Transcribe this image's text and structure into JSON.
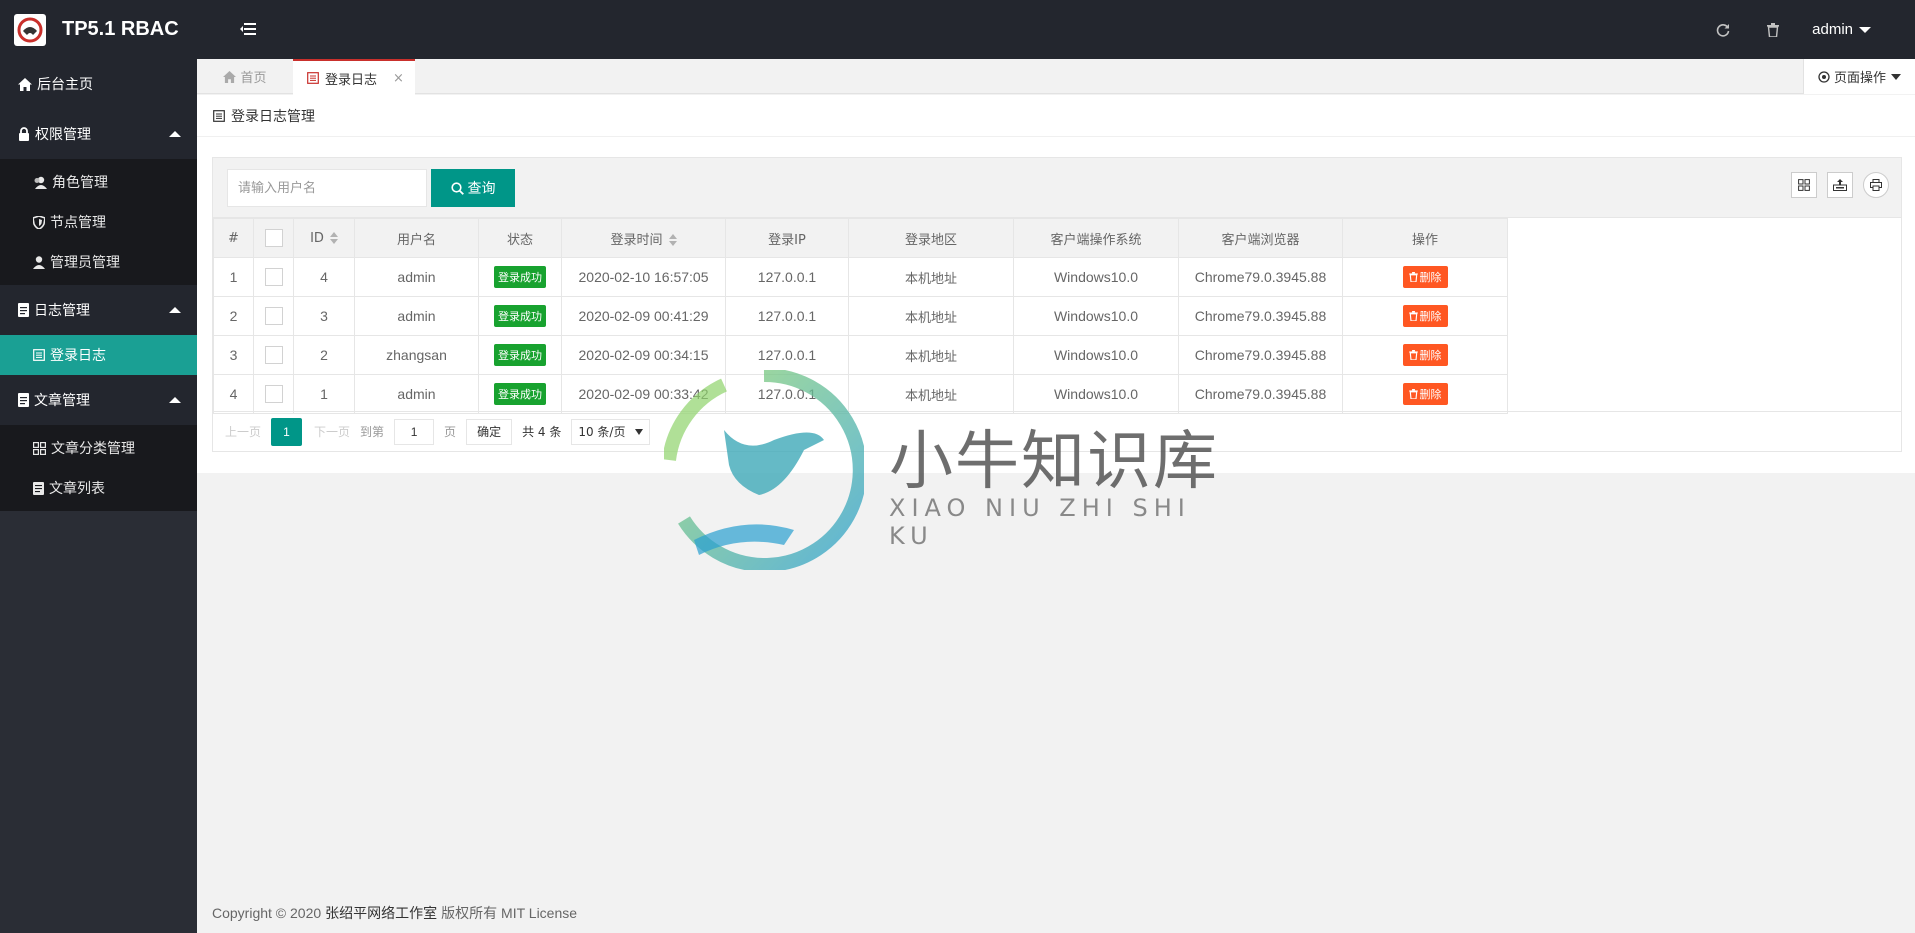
{
  "app": {
    "title": "TP5.1 RBAC"
  },
  "header": {
    "user": "admin",
    "icons": [
      "refresh-icon",
      "trash-icon"
    ]
  },
  "sidebar": {
    "home": {
      "label": "后台主页",
      "icon": "home-icon"
    },
    "groups": [
      {
        "label": "权限管理",
        "icon": "lock-icon",
        "items": [
          {
            "label": "角色管理",
            "icon": "users-icon"
          },
          {
            "label": "节点管理",
            "icon": "shield-icon"
          },
          {
            "label": "管理员管理",
            "icon": "user-icon"
          }
        ]
      },
      {
        "label": "日志管理",
        "icon": "file-icon",
        "items": [
          {
            "label": "登录日志",
            "icon": "log-icon",
            "active": true
          }
        ]
      },
      {
        "label": "文章管理",
        "icon": "file-icon",
        "items": [
          {
            "label": "文章分类管理",
            "icon": "grid-icon"
          },
          {
            "label": "文章列表",
            "icon": "doc-icon"
          }
        ]
      }
    ]
  },
  "tabs": {
    "home": "首页",
    "active": "登录日志",
    "close": "×",
    "page_ops": "页面操作"
  },
  "card": {
    "title": "登录日志管理"
  },
  "search": {
    "placeholder": "请输入用户名",
    "button": "查询"
  },
  "table": {
    "headers": [
      "#",
      "",
      "ID",
      "用户名",
      "状态",
      "登录时间",
      "登录IP",
      "登录地区",
      "客户端操作系统",
      "客户端浏览器",
      "操作"
    ],
    "rows": [
      {
        "num": "1",
        "id": "4",
        "username": "admin",
        "status": "登录成功",
        "time": "2020-02-10 16:57:05",
        "ip": "127.0.0.1",
        "region": "本机地址",
        "os": "Windows10.0",
        "browser": "Chrome79.0.3945.88",
        "action": "删除"
      },
      {
        "num": "2",
        "id": "3",
        "username": "admin",
        "status": "登录成功",
        "time": "2020-02-09 00:41:29",
        "ip": "127.0.0.1",
        "region": "本机地址",
        "os": "Windows10.0",
        "browser": "Chrome79.0.3945.88",
        "action": "删除"
      },
      {
        "num": "3",
        "id": "2",
        "username": "zhangsan",
        "status": "登录成功",
        "time": "2020-02-09 00:34:15",
        "ip": "127.0.0.1",
        "region": "本机地址",
        "os": "Windows10.0",
        "browser": "Chrome79.0.3945.88",
        "action": "删除"
      },
      {
        "num": "4",
        "id": "1",
        "username": "admin",
        "status": "登录成功",
        "time": "2020-02-09 00:33:42",
        "ip": "127.0.0.1",
        "region": "本机地址",
        "os": "Windows10.0",
        "browser": "Chrome79.0.3945.88",
        "action": "删除"
      }
    ]
  },
  "pager": {
    "prev": "上一页",
    "current": "1",
    "next": "下一页",
    "goto": "到第",
    "goto_value": "1",
    "page_unit": "页",
    "ok": "确定",
    "total": "共 4 条",
    "limit": "10 条/页"
  },
  "watermark": {
    "title": "小牛知识库",
    "subtitle": "XIAO NIU ZHI SHI KU"
  },
  "footer": {
    "copyright": "Copyright © 2020",
    "owner": "张绍平网络工作室",
    "rights": "版权所有 MIT License"
  },
  "colors": {
    "accent": "#009688",
    "sidebar_active": "#1aa094",
    "header": "#23262e",
    "danger": "#ff5722",
    "success": "#18a22f",
    "tab_border": "#c9302c"
  }
}
